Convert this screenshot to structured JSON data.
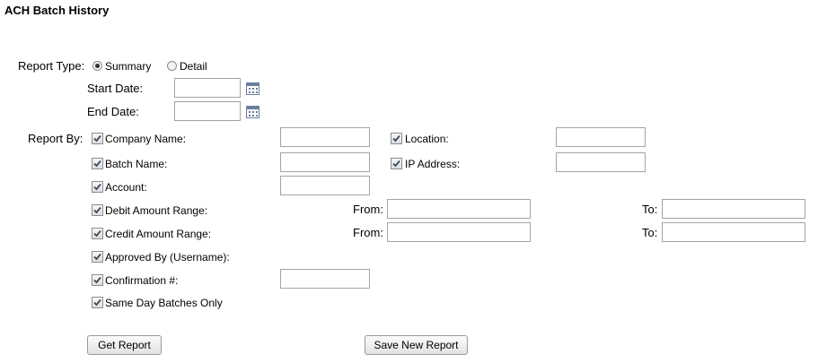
{
  "page": {
    "title": "ACH Batch History"
  },
  "report_type": {
    "label": "Report Type:",
    "options": [
      {
        "label": "Summary",
        "selected": true
      },
      {
        "label": "Detail",
        "selected": false
      }
    ]
  },
  "dates": {
    "start_label": "Start Date:",
    "start_value": "",
    "end_label": "End Date:",
    "end_value": ""
  },
  "report_by": {
    "label": "Report By:",
    "company_name": {
      "label": "Company Name:",
      "checked": true,
      "value": ""
    },
    "location": {
      "label": "Location:",
      "checked": true,
      "value": ""
    },
    "batch_name": {
      "label": "Batch Name:",
      "checked": true,
      "value": ""
    },
    "ip_address": {
      "label": "IP Address:",
      "checked": true,
      "value": ""
    },
    "account": {
      "label": "Account:",
      "checked": true,
      "value": ""
    },
    "debit_range": {
      "label": "Debit Amount Range:",
      "checked": true,
      "from_label": "From:",
      "to_label": "To:",
      "from_value": "",
      "to_value": ""
    },
    "credit_range": {
      "label": "Credit Amount Range:",
      "checked": true,
      "from_label": "From:",
      "to_label": "To:",
      "from_value": "",
      "to_value": ""
    },
    "approved_by": {
      "label": "Approved By (Username):",
      "checked": true
    },
    "confirmation": {
      "label": "Confirmation #:",
      "checked": true,
      "value": ""
    },
    "same_day": {
      "label": "Same Day Batches Only",
      "checked": true
    }
  },
  "actions": {
    "get_report": "Get Report",
    "save_new_report": "Save New Report"
  }
}
